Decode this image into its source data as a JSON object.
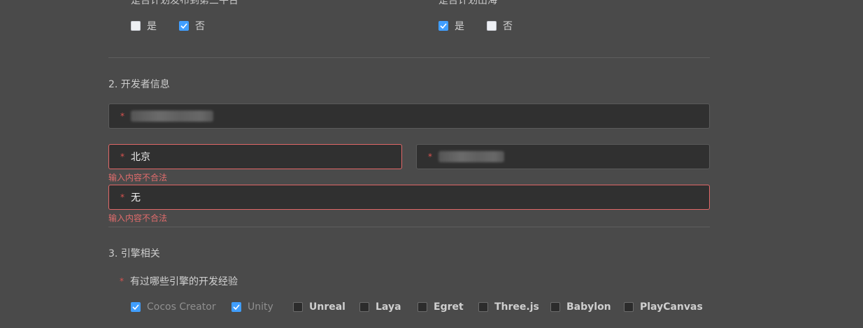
{
  "platform_section": {
    "question_partial": "是否计划发布到第三平台",
    "options": [
      {
        "label": "是",
        "checked": false
      },
      {
        "label": "否",
        "checked": true
      }
    ]
  },
  "overseas_section": {
    "question_partial": "是否计划出海",
    "options": [
      {
        "label": "是",
        "checked": true
      },
      {
        "label": "否",
        "checked": false
      }
    ]
  },
  "developer_section": {
    "title": "2. 开发者信息",
    "city_value": "北京",
    "city_error": "输入内容不合法",
    "third_value": "无",
    "third_error": "输入内容不合法"
  },
  "engine_section": {
    "title": "3. 引擎相关",
    "question": "有过哪些引擎的开发经验",
    "engines": [
      {
        "label": "Cocos Creator",
        "checked": true
      },
      {
        "label": "Unity",
        "checked": true
      },
      {
        "label": "Unreal",
        "checked": false
      },
      {
        "label": "Laya",
        "checked": false
      },
      {
        "label": "Egret",
        "checked": false
      },
      {
        "label": "Three.js",
        "checked": false
      },
      {
        "label": "Babylon",
        "checked": false
      },
      {
        "label": "PlayCanvas",
        "checked": false
      }
    ]
  },
  "colors": {
    "background": "#4a4a4a",
    "input_bg": "#303030",
    "accent": "#409eff",
    "error": "#e06c6c"
  }
}
